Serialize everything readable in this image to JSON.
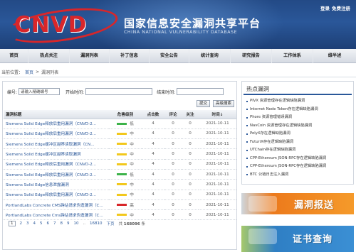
{
  "header": {
    "logo_text": "CNVD",
    "site_name_cn": "国家信息安全漏洞共享平台",
    "site_name_en": "CHINA NATIONAL VULNERABILITY DATABASE",
    "login": "登录",
    "register": "免费注册"
  },
  "nav": {
    "items": [
      "首页",
      "热点关注",
      "漏洞列表",
      "补丁信息",
      "安全公告",
      "统计查询",
      "研究报告",
      "工作体系",
      "维半述"
    ]
  },
  "breadcrumb": {
    "prefix": "当前位置：",
    "home": "首页",
    "sep": ">",
    "current": "漏洞列表"
  },
  "search": {
    "id_label": "编号:",
    "id_value": "请输入精确编号",
    "start_label": "开始时间:",
    "end_label": "结束时间:",
    "submit_label": "提交",
    "advanced_label": "高级搜索"
  },
  "table": {
    "headers": [
      "漏洞标题",
      "危害级别",
      "点击数",
      "评论",
      "关注",
      "时间"
    ],
    "sort_arrow": "↓",
    "rows": [
      {
        "title": "Siemens Solid Edge释放后重用漏洞（CNVD-2...",
        "level": "低",
        "level_color": "#3cb34a",
        "clicks": "4",
        "comments": "0",
        "follows": "0",
        "date": "2021-10-11"
      },
      {
        "title": "Siemens Solid Edge释放后重用漏洞（CNVD-2...",
        "level": "中",
        "level_color": "#f2c81c",
        "clicks": "4",
        "comments": "0",
        "follows": "0",
        "date": "2021-10-11"
      },
      {
        "title": "Siemens Solid Edge缓冲区越界读取漏洞（CN...",
        "level": "中",
        "level_color": "#f2c81c",
        "clicks": "4",
        "comments": "0",
        "follows": "0",
        "date": "2021-10-11"
      },
      {
        "title": "Siemens Solid Edge缓冲区越界读取漏洞",
        "level": "中",
        "level_color": "#f2c81c",
        "clicks": "4",
        "comments": "0",
        "follows": "0",
        "date": "2021-10-11"
      },
      {
        "title": "Siemens Solid Edge释放后重用漏洞（CNVD-2...",
        "level": "中",
        "level_color": "#f2c81c",
        "clicks": "4",
        "comments": "0",
        "follows": "0",
        "date": "2021-10-11"
      },
      {
        "title": "Siemens Solid Edge释放后重用漏洞（CNVD-2...",
        "level": "低",
        "level_color": "#3cb34a",
        "clicks": "4",
        "comments": "0",
        "follows": "0",
        "date": "2021-10-11"
      },
      {
        "title": "Siemens Solid Edge信息泄露漏洞",
        "level": "中",
        "level_color": "#f2c81c",
        "clicks": "4",
        "comments": "0",
        "follows": "0",
        "date": "2021-10-11"
      },
      {
        "title": "Siemens Solid Edge释放后重用漏洞（CNVD-2...",
        "level": "中",
        "level_color": "#f2c81c",
        "clicks": "4",
        "comments": "0",
        "follows": "0",
        "date": "2021-10-11"
      },
      {
        "title": "PortlandLabs Concrete CMS跨站请求伪造漏洞（C...",
        "level": "高",
        "level_color": "#d8262a",
        "clicks": "4",
        "comments": "0",
        "follows": "0",
        "date": "2021-10-11"
      },
      {
        "title": "PortlandLabs Concrete Cms跨站请求伪造漏洞（C...",
        "level": "中",
        "level_color": "#f2c81c",
        "clicks": "4",
        "comments": "0",
        "follows": "0",
        "date": "2021-10-11"
      }
    ]
  },
  "pagination": {
    "pages": [
      "1",
      "2",
      "3",
      "4",
      "5",
      "6",
      "7",
      "8",
      "9",
      "10"
    ],
    "ellipsis": "..",
    "last_page": "16810",
    "next": "下页",
    "total_label": "共",
    "total": "168096",
    "unit": "条"
  },
  "sidebar": {
    "title": "热点漏洞",
    "items": [
      "PIVX 资源管理存在逻辑缺陷漏洞",
      "Internet Node Token存在逻辑缺陷漏洞",
      "Phore 资源管理错误漏洞",
      "NavCoin 资源管理存在逻辑缺陷漏洞",
      "PolyX存在逻辑缺陷漏洞",
      "FuturiX存在逻辑缺陷漏洞",
      "UTChain存在逻辑缺陷漏洞",
      "CPP-Ethereum JSON-RPC存在逻辑缺陷漏洞",
      "CPP-Ethereum JSON-RPC存在逻辑缺陷漏洞",
      "BTC 公链日志注入漏洞"
    ]
  },
  "promos": {
    "report": "漏洞报送",
    "cert": "证书查询"
  }
}
